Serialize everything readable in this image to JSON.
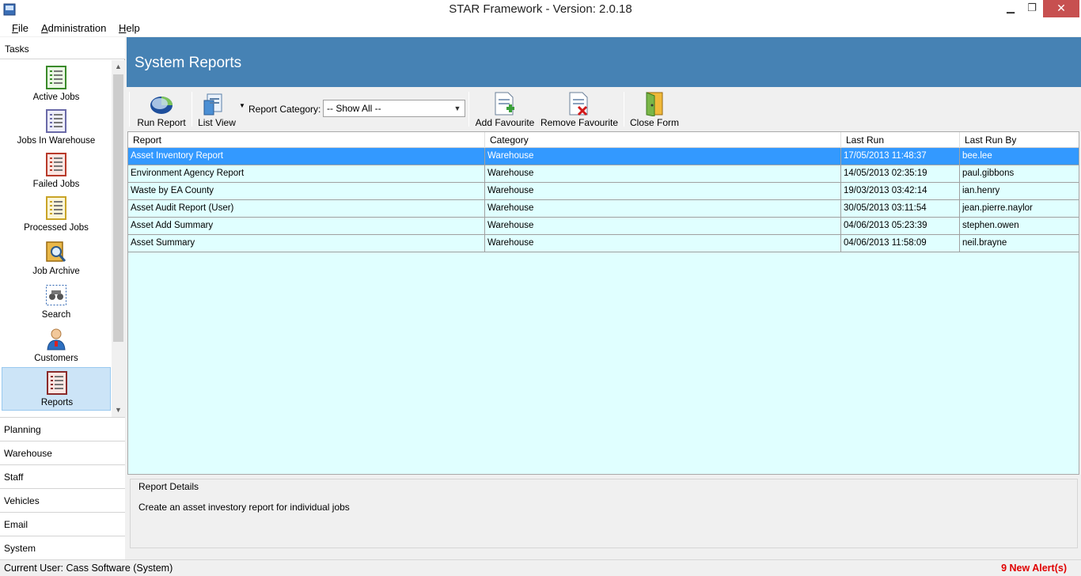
{
  "window": {
    "title": "STAR Framework - Version: 2.0.18",
    "min": "▁",
    "max": "❐",
    "close": "✕"
  },
  "menu": [
    {
      "first": "F",
      "rest": "ile"
    },
    {
      "first": "A",
      "rest": "dministration"
    },
    {
      "first": "H",
      "rest": "elp"
    }
  ],
  "nav": {
    "header": "Tasks",
    "tasks": [
      {
        "label": "Active Jobs",
        "icon": "report-green-icon"
      },
      {
        "label": "Jobs In Warehouse",
        "icon": "report-purple-icon"
      },
      {
        "label": "Failed Jobs",
        "icon": "report-red-icon"
      },
      {
        "label": "Processed Jobs",
        "icon": "report-yellow-icon"
      },
      {
        "label": "Job Archive",
        "icon": "archive-search-icon"
      },
      {
        "label": "Search",
        "icon": "binoculars-icon"
      },
      {
        "label": "Customers",
        "icon": "customer-person-icon"
      },
      {
        "label": "Reports",
        "icon": "reports-icon"
      }
    ],
    "sections": [
      "Planning",
      "Warehouse",
      "Staff",
      "Vehicles",
      "Email",
      "System"
    ]
  },
  "page": {
    "heading": "System Reports"
  },
  "toolbar": {
    "run_report": "Run Report",
    "list_view": "List View",
    "category_label": "Report Category:",
    "category_value": "-- Show All --",
    "add_favourite": "Add Favourite",
    "remove_favourite": "Remove Favourite",
    "close_form": "Close Form"
  },
  "grid": {
    "columns": [
      "Report",
      "Category",
      "Last Run",
      "Last Run By"
    ],
    "rows": [
      [
        "Asset Inventory Report",
        "Warehouse",
        "17/05/2013 11:48:37",
        "bee.lee"
      ],
      [
        "Environment Agency Report",
        "Warehouse",
        "14/05/2013 02:35:19",
        "paul.gibbons"
      ],
      [
        "Waste by EA County",
        "Warehouse",
        "19/03/2013 03:42:14",
        "ian.henry"
      ],
      [
        "Asset Audit Report (User)",
        "Warehouse",
        "30/05/2013 03:11:54",
        "jean.pierre.naylor"
      ],
      [
        "Asset Add Summary",
        "Warehouse",
        "04/06/2013 05:23:39",
        "stephen.owen"
      ],
      [
        "Asset Summary",
        "Warehouse",
        "04/06/2013 11:58:09",
        "neil.brayne"
      ]
    ],
    "selected_row": 0
  },
  "details": {
    "title": "Report Details",
    "text": "Create an asset investory report for individual jobs"
  },
  "status": {
    "user": "Current User: Cass Software (System)",
    "alerts": "9 New Alert(s)"
  }
}
